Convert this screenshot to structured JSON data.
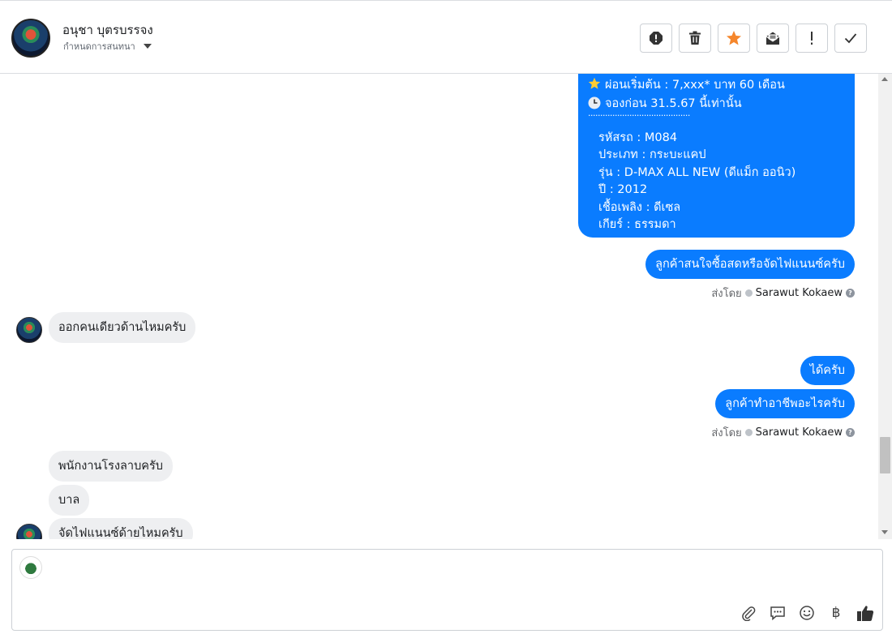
{
  "header": {
    "contact_name": "อนุชา บุตรบรรจง",
    "subtitle": "กำหนดการสนทนา"
  },
  "toolbar": {
    "buttons": [
      "spam",
      "delete",
      "star",
      "mark-unread",
      "important",
      "done"
    ]
  },
  "messages": {
    "card": {
      "line1": "ผ่อนเริ่มต้น : 7,xxx* บาท 60 เดือน",
      "line2": "จองก่อน 31.5.67 นี้เท่านั้น",
      "divider": "..........................................",
      "code": "รหัสรถ : M084",
      "type": "ประเภท : กระบะแคป",
      "model": "รุ่น : D-MAX ALL NEW (ดีแม็ก ออนิว)",
      "year": "ปี : 2012",
      "fuel": "เชื้อเพลิง : ดีเซล",
      "gear": "เกียร์ : ธรรมดา"
    },
    "out1": "ลูกค้าสนใจซื้อสดหรือจัดไฟแนนซ์ครับ",
    "sent_by_label": "ส่งโดย",
    "sent_by_name": "Sarawut Kokaew",
    "in1": "ออกคนเดียวด้านไหมครับ",
    "out2": "ได้ครับ",
    "out3": "ลูกค้าทำอาชีพอะไรครับ",
    "in2": "พนักงานโรงลาบครับ",
    "in3": "บาล",
    "in4": "จัดไฟแนนซ์ด้ายไหมครับ"
  },
  "composer": {
    "value": "",
    "icons": [
      "attachment-icon",
      "saved-reply-icon",
      "emoji-icon",
      "baht-icon",
      "like-icon"
    ],
    "baht_symbol": "฿"
  },
  "colors": {
    "outgoing": "#0a7cff",
    "incoming": "#eeeff1",
    "star": "#f5862c"
  }
}
